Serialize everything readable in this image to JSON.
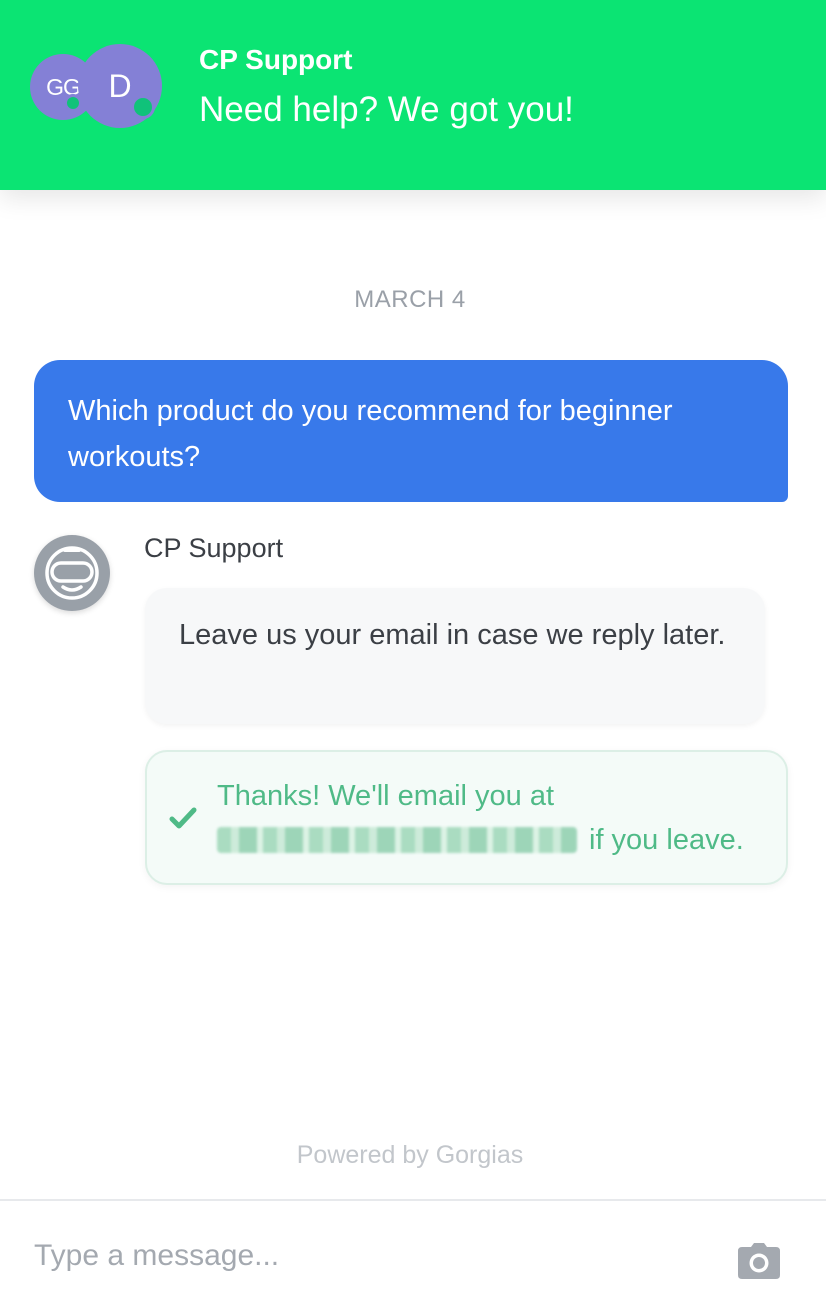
{
  "header": {
    "avatars": [
      {
        "initials": "GG",
        "color": "#8480d6"
      },
      {
        "initials": "D",
        "color": "#8480d6"
      }
    ],
    "title": "CP Support",
    "subtitle": "Need help? We got you!",
    "background_color": "#0be473"
  },
  "conversation": {
    "date_separator": "MARCH 4",
    "user_message": "Which product do you recommend for beginner workouts?",
    "user_bubble_color": "#3879ea",
    "agent_name": "CP Support",
    "agent_avatar_icon": "bot-face-icon",
    "agent_message": "Leave us your email in case we reply later.",
    "confirmation": {
      "icon": "check-icon",
      "text_before": "Thanks! We'll email you at",
      "text_after": "if you leave.",
      "color": "#4fba87"
    }
  },
  "footer": {
    "powered_by": "Powered by Gorgias",
    "input_placeholder": "Type a message...",
    "attach_icon": "camera-icon"
  }
}
